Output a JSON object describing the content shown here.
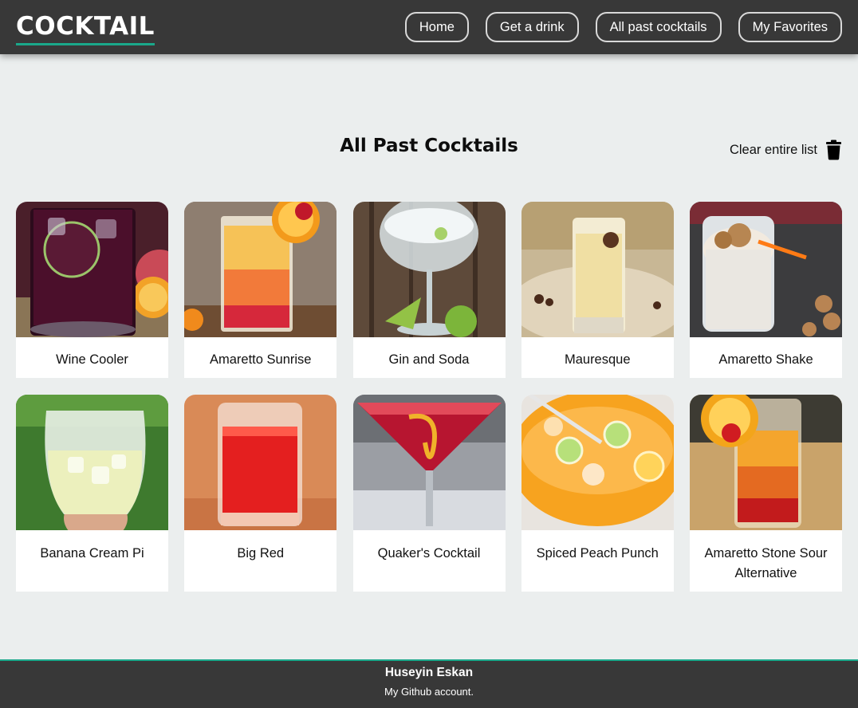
{
  "header": {
    "brand": "COCKTAIL",
    "nav": [
      "Home",
      "Get a drink",
      "All past cocktails",
      "My Favorites"
    ]
  },
  "main": {
    "title": "All Past Cocktails",
    "clear_label": "Clear entire list",
    "clear_icon": "trash-icon",
    "cocktails": [
      {
        "name": "Wine Cooler"
      },
      {
        "name": "Amaretto Sunrise"
      },
      {
        "name": "Gin and Soda"
      },
      {
        "name": "Mauresque"
      },
      {
        "name": "Amaretto Shake"
      },
      {
        "name": "Banana Cream Pi"
      },
      {
        "name": "Big Red"
      },
      {
        "name": "Quaker's Cocktail"
      },
      {
        "name": "Spiced Peach Punch"
      },
      {
        "name": "Amaretto Stone Sour Alternative"
      }
    ]
  },
  "footer": {
    "name": "Huseyin Eskan",
    "link": "My Github account."
  },
  "colors": {
    "header_bg": "#383838",
    "accent": "#1aa88a",
    "page_bg": "#ebeeee"
  }
}
